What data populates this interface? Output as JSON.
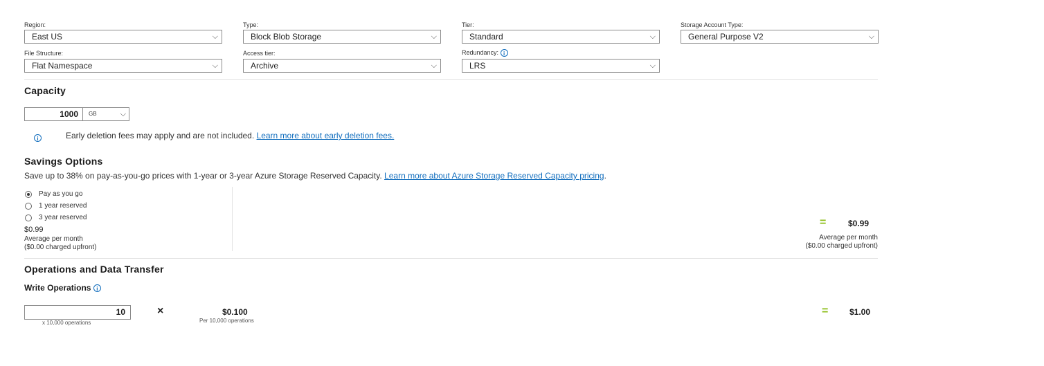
{
  "fields": {
    "region": {
      "label": "Region:",
      "value": "East US"
    },
    "type": {
      "label": "Type:",
      "value": "Block Blob Storage"
    },
    "tier": {
      "label": "Tier:",
      "value": "Standard"
    },
    "account_type": {
      "label": "Storage Account Type:",
      "value": "General Purpose V2"
    },
    "file_structure": {
      "label": "File Structure:",
      "value": "Flat Namespace"
    },
    "access_tier": {
      "label": "Access tier:",
      "value": "Archive"
    },
    "redundancy": {
      "label": "Redundancy:",
      "value": "LRS"
    }
  },
  "capacity": {
    "title": "Capacity",
    "amount": "1000",
    "unit": "GB",
    "notice_text": "Early deletion fees may apply and are not included.",
    "notice_link": "Learn more about early deletion fees."
  },
  "savings": {
    "title": "Savings Options",
    "description": "Save up to 38% on pay-as-you-go prices with 1-year or 3-year Azure Storage Reserved Capacity.",
    "link": "Learn more about Azure Storage Reserved Capacity pricing",
    "link_suffix": ".",
    "options": [
      {
        "label": "Pay as you go",
        "selected": true
      },
      {
        "label": "1 year reserved",
        "selected": false
      },
      {
        "label": "3 year reserved",
        "selected": false
      }
    ],
    "left_price": "$0.99",
    "left_caption": "Average per month",
    "left_upfront": "($0.00 charged upfront)",
    "equals": "=",
    "right_price": "$0.99",
    "right_caption": "Average per month",
    "right_upfront": "($0.00 charged upfront)"
  },
  "operations": {
    "title": "Operations and Data Transfer",
    "write_label": "Write Operations",
    "write_quantity": "10",
    "write_quantity_caption": "x 10,000 operations",
    "times": "×",
    "write_unit_price": "$0.100",
    "write_unit_caption": "Per 10,000 operations",
    "equals": "=",
    "write_total": "$1.00"
  },
  "icons": {
    "info": "info-icon",
    "chevron": "chevron-down-icon"
  },
  "colors": {
    "link": "#0f6cbd",
    "equals": "#8cbd18"
  }
}
